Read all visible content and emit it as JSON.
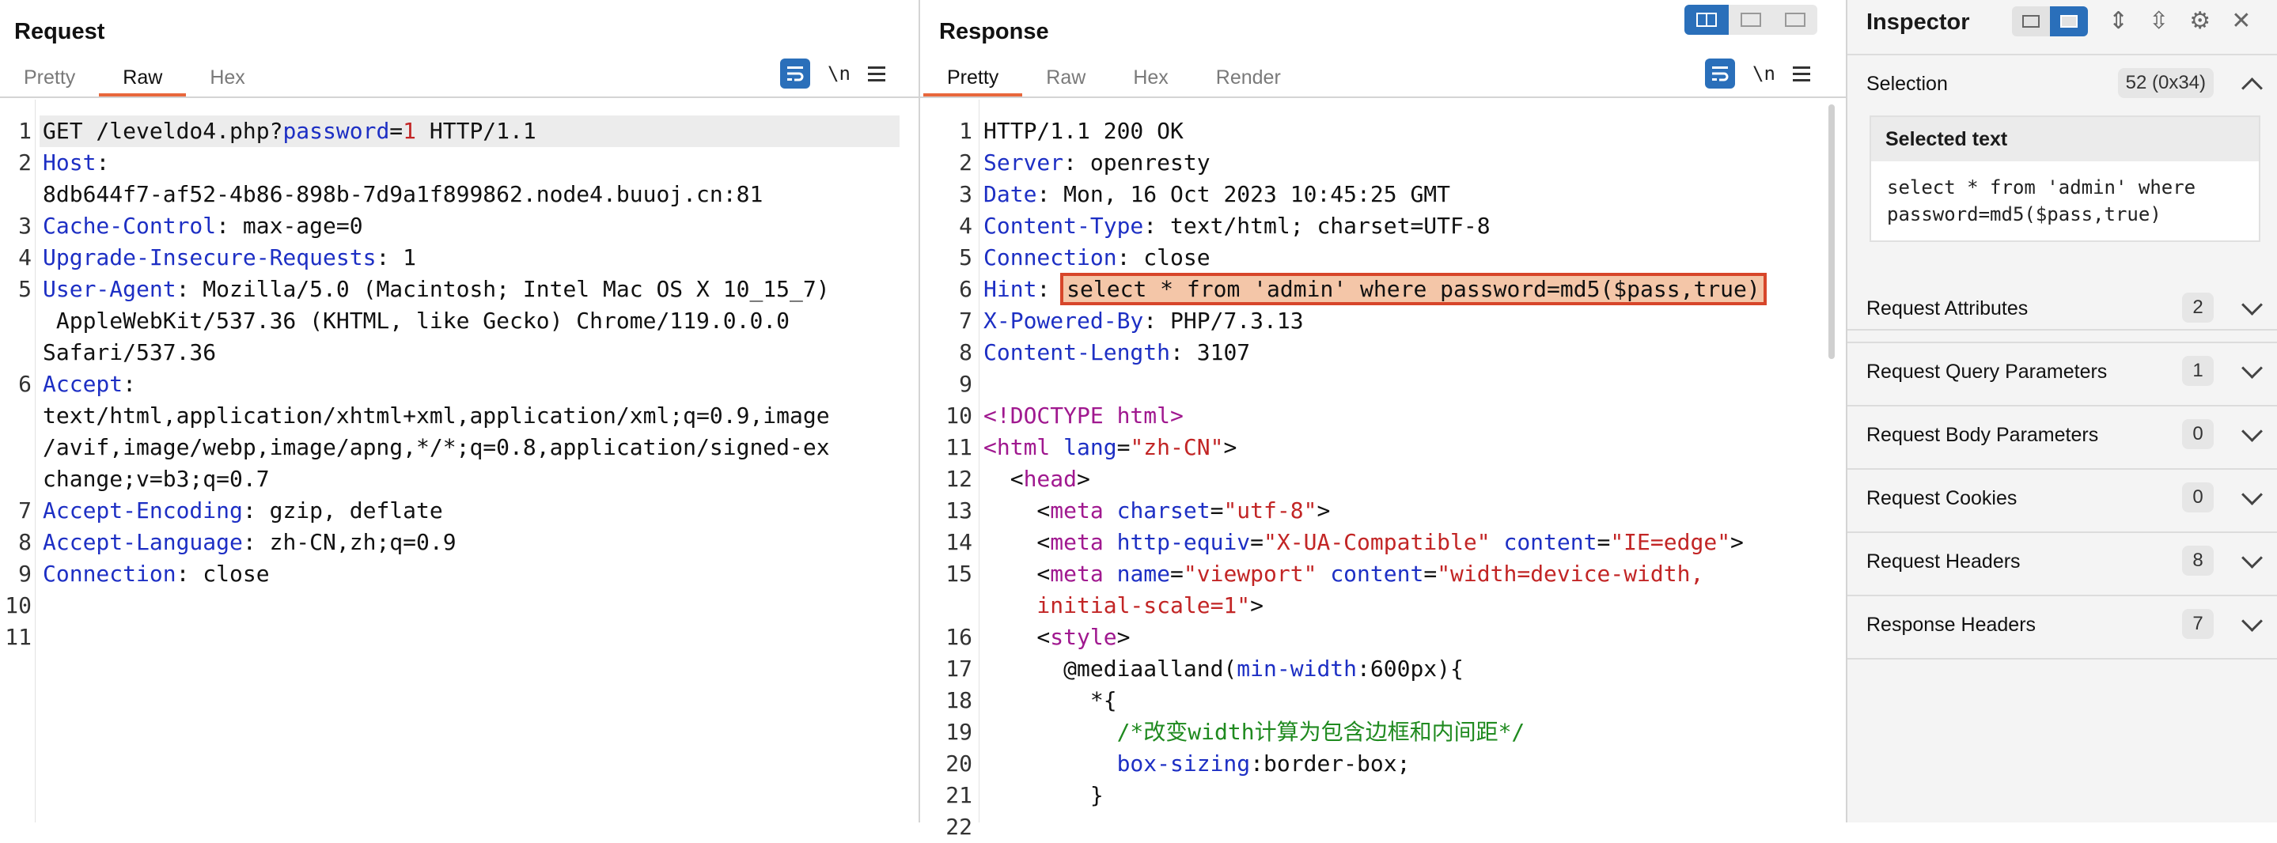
{
  "request": {
    "title": "Request",
    "tabs": [
      "Pretty",
      "Raw",
      "Hex"
    ],
    "active_tab": "Raw",
    "tool_newline": "\\n",
    "lines": [
      {
        "n": "1",
        "parts": [
          [
            "txt",
            "GET /leveldo4.php?"
          ],
          [
            "k",
            "password"
          ],
          [
            "txt",
            "="
          ],
          [
            "o",
            "1"
          ],
          [
            "txt",
            " HTTP/1.1"
          ]
        ]
      },
      {
        "n": "2",
        "parts": [
          [
            "k",
            "Host"
          ],
          [
            "txt",
            ":"
          ]
        ]
      },
      {
        "n": "",
        "parts": [
          [
            "txt",
            "8db644f7-af52-4b86-898b-7d9a1f899862.node4.buuoj.cn:81"
          ]
        ]
      },
      {
        "n": "3",
        "parts": [
          [
            "k",
            "Cache-Control"
          ],
          [
            "txt",
            ": max-age=0"
          ]
        ]
      },
      {
        "n": "4",
        "parts": [
          [
            "k",
            "Upgrade-Insecure-Requests"
          ],
          [
            "txt",
            ": 1"
          ]
        ]
      },
      {
        "n": "5",
        "parts": [
          [
            "k",
            "User-Agent"
          ],
          [
            "txt",
            ": Mozilla/5.0 (Macintosh; Intel Mac OS X 10_15_7)"
          ]
        ]
      },
      {
        "n": "",
        "parts": [
          [
            "txt",
            " AppleWebKit/537.36 (KHTML, like Gecko) Chrome/119.0.0.0"
          ]
        ]
      },
      {
        "n": "",
        "parts": [
          [
            "txt",
            "Safari/537.36"
          ]
        ]
      },
      {
        "n": "6",
        "parts": [
          [
            "k",
            "Accept"
          ],
          [
            "txt",
            ":"
          ]
        ]
      },
      {
        "n": "",
        "parts": [
          [
            "txt",
            "text/html,application/xhtml+xml,application/xml;q=0.9,image"
          ]
        ]
      },
      {
        "n": "",
        "parts": [
          [
            "txt",
            "/avif,image/webp,image/apng,*/*;q=0.8,application/signed-ex"
          ]
        ]
      },
      {
        "n": "",
        "parts": [
          [
            "txt",
            "change;v=b3;q=0.7"
          ]
        ]
      },
      {
        "n": "7",
        "parts": [
          [
            "k",
            "Accept-Encoding"
          ],
          [
            "txt",
            ": gzip, deflate"
          ]
        ]
      },
      {
        "n": "8",
        "parts": [
          [
            "k",
            "Accept-Language"
          ],
          [
            "txt",
            ": zh-CN,zh;q=0.9"
          ]
        ]
      },
      {
        "n": "9",
        "parts": [
          [
            "k",
            "Connection"
          ],
          [
            "txt",
            ": close"
          ]
        ]
      },
      {
        "n": "10",
        "parts": []
      },
      {
        "n": "11",
        "parts": []
      }
    ]
  },
  "response": {
    "title": "Response",
    "tabs": [
      "Pretty",
      "Raw",
      "Hex",
      "Render"
    ],
    "active_tab": "Pretty",
    "tool_newline": "\\n",
    "lines": [
      {
        "n": "1",
        "parts": [
          [
            "txt",
            "HTTP/1.1 200 OK"
          ]
        ]
      },
      {
        "n": "2",
        "parts": [
          [
            "k",
            "Server"
          ],
          [
            "txt",
            ": openresty"
          ]
        ]
      },
      {
        "n": "3",
        "parts": [
          [
            "k",
            "Date"
          ],
          [
            "txt",
            ": Mon, 16 Oct 2023 10:45:25 GMT"
          ]
        ]
      },
      {
        "n": "4",
        "parts": [
          [
            "k",
            "Content-Type"
          ],
          [
            "txt",
            ": text/html; charset=UTF-8"
          ]
        ]
      },
      {
        "n": "5",
        "parts": [
          [
            "k",
            "Connection"
          ],
          [
            "txt",
            ": close"
          ]
        ]
      },
      {
        "n": "6",
        "parts": [
          [
            "k",
            "Hint"
          ],
          [
            "txt",
            ": "
          ],
          [
            "sel",
            "select * from 'admin' where password=md5($pass,true)"
          ]
        ]
      },
      {
        "n": "7",
        "parts": [
          [
            "k",
            "X-Powered-By"
          ],
          [
            "txt",
            ": PHP/7.3.13"
          ]
        ]
      },
      {
        "n": "8",
        "parts": [
          [
            "k",
            "Content-Length"
          ],
          [
            "txt",
            ": 3107"
          ]
        ]
      },
      {
        "n": "9",
        "parts": []
      },
      {
        "n": "10",
        "parts": [
          [
            "tg",
            "<!DOCTYPE html>"
          ]
        ]
      },
      {
        "n": "11",
        "parts": [
          [
            "tg",
            "<html"
          ],
          [
            "at",
            " lang"
          ],
          [
            "txt",
            "="
          ],
          [
            "av",
            "\"zh-CN\""
          ],
          [
            "txt",
            ">"
          ]
        ]
      },
      {
        "n": "12",
        "parts": [
          [
            "txt",
            "  <"
          ],
          [
            "tg",
            "head"
          ],
          [
            "txt",
            ">"
          ]
        ]
      },
      {
        "n": "13",
        "parts": [
          [
            "txt",
            "    <"
          ],
          [
            "tg",
            "meta"
          ],
          [
            "at",
            " charset"
          ],
          [
            "txt",
            "="
          ],
          [
            "av",
            "\"utf-8\""
          ],
          [
            "txt",
            ">"
          ]
        ]
      },
      {
        "n": "14",
        "parts": [
          [
            "txt",
            "    <"
          ],
          [
            "tg",
            "meta"
          ],
          [
            "at",
            " http-equiv"
          ],
          [
            "txt",
            "="
          ],
          [
            "av",
            "\"X-UA-Compatible\""
          ],
          [
            "at",
            " content"
          ],
          [
            "txt",
            "="
          ],
          [
            "av",
            "\"IE=edge\""
          ],
          [
            "txt",
            ">"
          ]
        ]
      },
      {
        "n": "15",
        "parts": [
          [
            "txt",
            "    <"
          ],
          [
            "tg",
            "meta"
          ],
          [
            "at",
            " name"
          ],
          [
            "txt",
            "="
          ],
          [
            "av",
            "\"viewport\""
          ],
          [
            "at",
            " content"
          ],
          [
            "txt",
            "="
          ],
          [
            "av",
            "\"width=device-width,"
          ]
        ]
      },
      {
        "n": "",
        "parts": [
          [
            "av",
            "    initial-scale=1\""
          ],
          [
            "txt",
            ">"
          ]
        ]
      },
      {
        "n": "16",
        "parts": [
          [
            "txt",
            "    <"
          ],
          [
            "tg",
            "style"
          ],
          [
            "txt",
            ">"
          ]
        ]
      },
      {
        "n": "17",
        "parts": [
          [
            "txt",
            "      @mediaalland("
          ],
          [
            "k",
            "min-width"
          ],
          [
            "txt",
            ":600px){"
          ]
        ]
      },
      {
        "n": "18",
        "parts": [
          [
            "txt",
            "        *{"
          ]
        ]
      },
      {
        "n": "19",
        "parts": [
          [
            "cm",
            "          /*改变width计算为包含边框和内间距*/"
          ]
        ]
      },
      {
        "n": "20",
        "parts": [
          [
            "k",
            "          box-sizing"
          ],
          [
            "txt",
            ":border-box;"
          ]
        ]
      },
      {
        "n": "21",
        "parts": [
          [
            "txt",
            "        }"
          ]
        ]
      },
      {
        "n": "22",
        "parts": []
      }
    ]
  },
  "inspector": {
    "title": "Inspector",
    "selection_label": "Selection",
    "selection_count": "52 (0x34)",
    "selected_text_title": "Selected text",
    "selected_text": "select * from 'admin' where\npassword=md5($pass,true)",
    "sections": [
      {
        "label": "Request Attributes",
        "count": "2"
      },
      {
        "label": "Request Query Parameters",
        "count": "1"
      },
      {
        "label": "Request Body Parameters",
        "count": "0"
      },
      {
        "label": "Request Cookies",
        "count": "0"
      },
      {
        "label": "Request Headers",
        "count": "8"
      },
      {
        "label": "Response Headers",
        "count": "7"
      }
    ]
  },
  "colors": {
    "accent": "#e8673c",
    "selection_border": "#d7462a",
    "toolbar_blue": "#2a6fba"
  }
}
